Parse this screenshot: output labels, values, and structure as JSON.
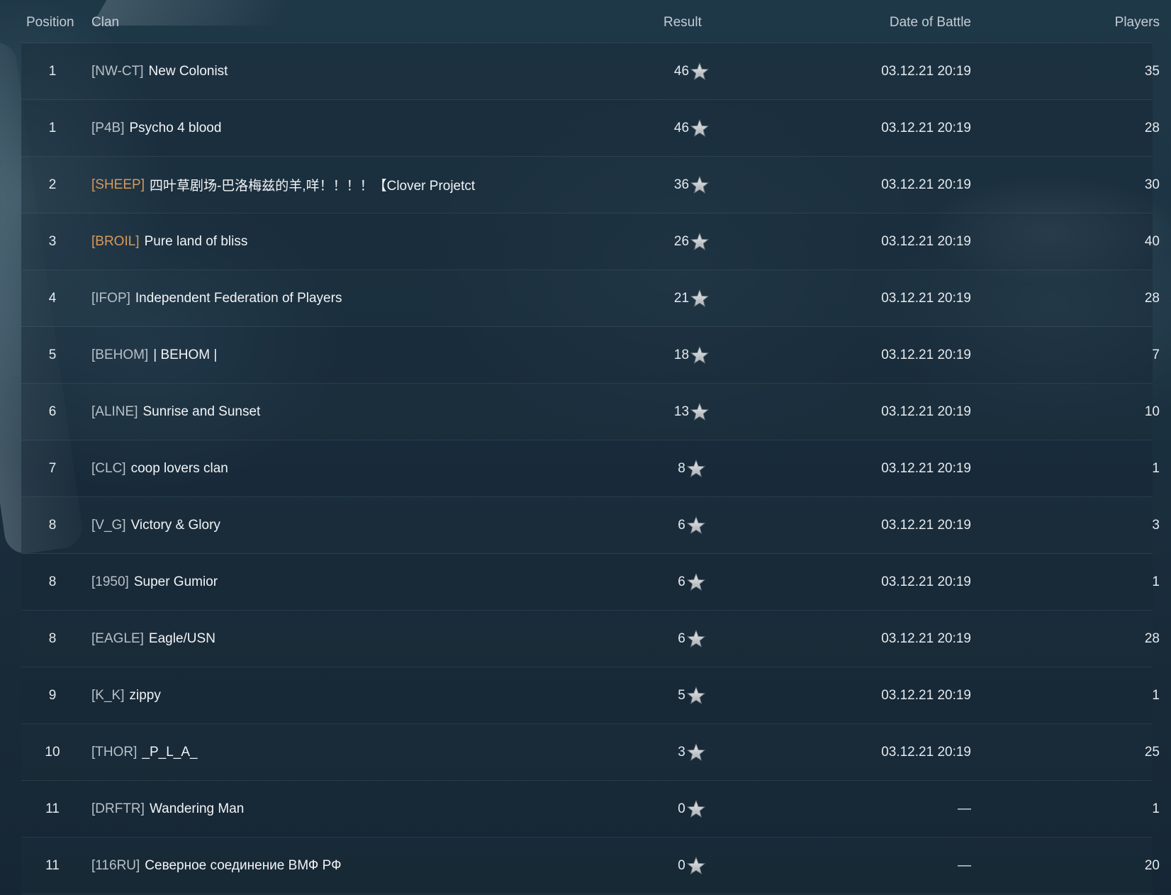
{
  "columns": {
    "position": "Position",
    "clan": "Clan",
    "result": "Result",
    "date": "Date of Battle",
    "players": "Players"
  },
  "colors": {
    "tag_default": "#b8c0c7",
    "tag_highlight": "#d79a5a",
    "text": "#f2f4f6"
  },
  "rows": [
    {
      "position": "1",
      "tag": "[NW-CT]",
      "name": "New Colonist",
      "result": "46",
      "date": "03.12.21 20:19",
      "players": "35",
      "highlight": false
    },
    {
      "position": "1",
      "tag": "[P4B]",
      "name": "Psycho 4 blood",
      "result": "46",
      "date": "03.12.21 20:19",
      "players": "28",
      "highlight": false
    },
    {
      "position": "2",
      "tag": "[SHEEP]",
      "name": "四叶草剧场-巴洛梅兹的羊,咩！！！！【Clover Projetct",
      "result": "36",
      "date": "03.12.21 20:19",
      "players": "30",
      "highlight": true
    },
    {
      "position": "3",
      "tag": "[BROIL]",
      "name": "Pure land of bliss",
      "result": "26",
      "date": "03.12.21 20:19",
      "players": "40",
      "highlight": true
    },
    {
      "position": "4",
      "tag": "[IFOP]",
      "name": "Independent Federation of Players",
      "result": "21",
      "date": "03.12.21 20:19",
      "players": "28",
      "highlight": false
    },
    {
      "position": "5",
      "tag": "[BEHOM]",
      "name": "| BEHOM |",
      "result": "18",
      "date": "03.12.21 20:19",
      "players": "7",
      "highlight": false
    },
    {
      "position": "6",
      "tag": "[ALINE]",
      "name": "Sunrise and Sunset",
      "result": "13",
      "date": "03.12.21 20:19",
      "players": "10",
      "highlight": false
    },
    {
      "position": "7",
      "tag": "[CLC]",
      "name": "coop lovers clan",
      "result": "8",
      "date": "03.12.21 20:19",
      "players": "1",
      "highlight": false
    },
    {
      "position": "8",
      "tag": "[V_G]",
      "name": "Victory & Glory",
      "result": "6",
      "date": "03.12.21 20:19",
      "players": "3",
      "highlight": false
    },
    {
      "position": "8",
      "tag": "[1950]",
      "name": "Super Gumior",
      "result": "6",
      "date": "03.12.21 20:19",
      "players": "1",
      "highlight": false
    },
    {
      "position": "8",
      "tag": "[EAGLE]",
      "name": "Eagle/USN",
      "result": "6",
      "date": "03.12.21 20:19",
      "players": "28",
      "highlight": false
    },
    {
      "position": "9",
      "tag": "[K_K]",
      "name": "zippy",
      "result": "5",
      "date": "03.12.21 20:19",
      "players": "1",
      "highlight": false
    },
    {
      "position": "10",
      "tag": "[THOR]",
      "name": "_P_L_A_",
      "result": "3",
      "date": "03.12.21 20:19",
      "players": "25",
      "highlight": false
    },
    {
      "position": "11",
      "tag": "[DRFTR]",
      "name": "Wandering Man",
      "result": "0",
      "date": "—",
      "players": "1",
      "highlight": false
    },
    {
      "position": "11",
      "tag": "[116RU]",
      "name": "Северное соединение ВМФ РФ",
      "result": "0",
      "date": "—",
      "players": "20",
      "highlight": false
    }
  ],
  "icons": {
    "result_icon": "star-icon"
  }
}
